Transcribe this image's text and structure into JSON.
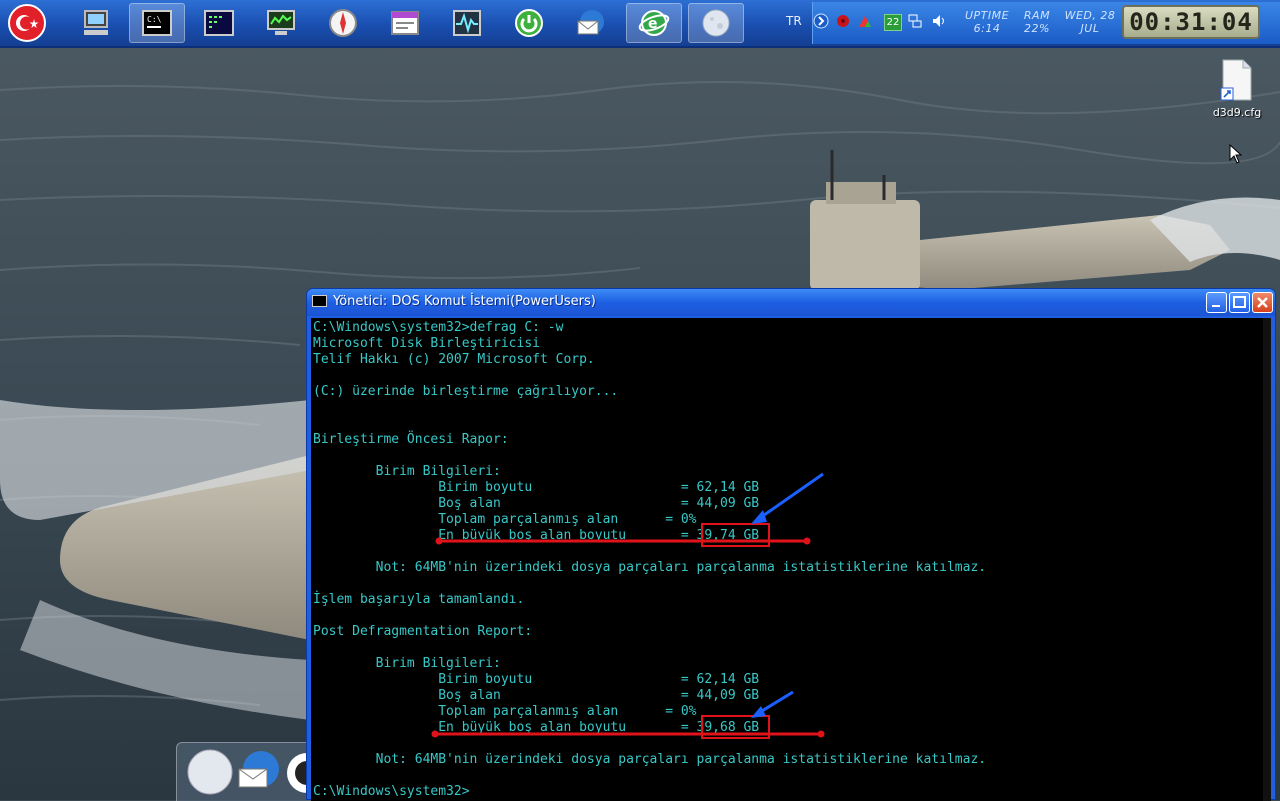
{
  "taskbar": {
    "lang": "TR",
    "badge": "22",
    "uptime_label": "UPTIME",
    "uptime_value": "6:14",
    "ram_label": "RAM",
    "ram_value": "22%",
    "date_line1": "WED, 28",
    "date_line2": "JUL",
    "clock": "00:31:04",
    "apps": [
      "start-orb-icon",
      "computer-icon",
      "console-icon",
      "terminal-icon",
      "monitor-icon",
      "compass-icon",
      "window-icon",
      "pulse-icon",
      "power-icon",
      "mail-icon",
      "ie-icon",
      "moon-icon"
    ]
  },
  "desktop": {
    "icon_label": "d3d9.cfg"
  },
  "window": {
    "title": "Yönetici: DOS Komut İstemi(PowerUsers)",
    "lines": [
      "C:\\Windows\\system32>defrag C: -w",
      "Microsoft Disk Birleştiricisi",
      "Telif Hakkı (c) 2007 Microsoft Corp.",
      "",
      "(C:) üzerinde birleştirme çağrılıyor...",
      "",
      "",
      "Birleştirme Öncesi Rapor:",
      "",
      "        Birim Bilgileri:",
      "                Birim boyutu                   = 62,14 GB",
      "                Boş alan                       = 44,09 GB",
      "                Toplam parçalanmış alan      = 0%",
      "                En büyük boş alan boyutu       = 39,74 GB",
      "",
      "        Not: 64MB'nin üzerindeki dosya parçaları parçalanma istatistiklerine katılmaz.",
      "",
      "İşlem başarıyla tamamlandı.",
      "",
      "Post Defragmentation Report:",
      "",
      "        Birim Bilgileri:",
      "                Birim boyutu                   = 62,14 GB",
      "                Boş alan                       = 44,09 GB",
      "                Toplam parçalanmış alan      = 0%",
      "                En büyük boş alan boyutu       = 39,68 GB",
      "",
      "        Not: 64MB'nin üzerindeki dosya parçaları parçalanma istatistiklerine katılmaz.",
      "",
      "C:\\Windows\\system32>"
    ]
  }
}
